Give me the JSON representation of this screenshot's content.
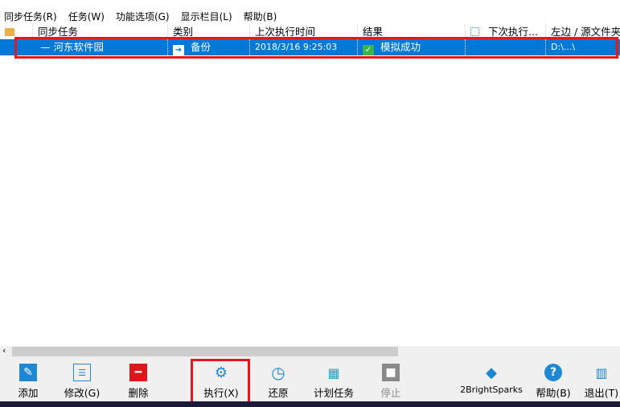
{
  "menu": [
    "同步任务(R)",
    "任务(W)",
    "功能选项(G)",
    "显示栏目(L)",
    "帮助(B)"
  ],
  "columns": [
    "同步任务",
    "类别",
    "上次执行时间",
    "结果",
    "下次执行...",
    "左边 / 源文件夹"
  ],
  "row": {
    "name": "河东软件园",
    "type": "备份",
    "last_run": "2018/3/16 9:25:03",
    "result": "模拟成功",
    "next_run": "",
    "left": "D:\\...\\"
  },
  "toolbar": [
    "添加",
    "修改(G)",
    "删除",
    "执行(X)",
    "还原",
    "计划任务",
    "停止",
    "2BrightSparks",
    "帮助(B)",
    "退出(T)"
  ],
  "watermark": "河东软件园",
  "colors": {
    "selection": "#0078d7",
    "highlight": "#e4161e"
  }
}
